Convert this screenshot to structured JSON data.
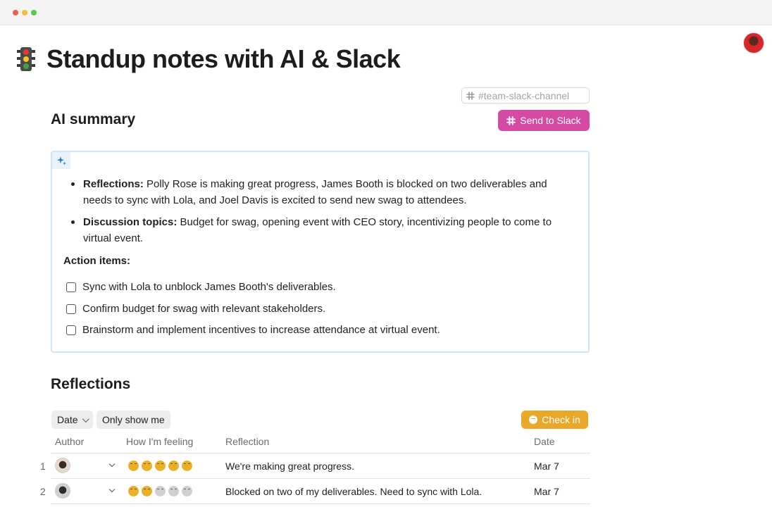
{
  "page": {
    "title": "Standup notes with AI & Slack",
    "icon": "traffic-light-icon"
  },
  "slack": {
    "channel_placeholder": "#team-slack-channel",
    "send_label": "Send to Slack",
    "accent": "#d54ba3"
  },
  "ai_summary": {
    "heading": "AI summary",
    "bullets": [
      {
        "label": "Reflections:",
        "text": " Polly Rose is making great progress, James Booth is blocked on two deliverables and needs to sync with Lola, and Joel Davis is excited to send new swag to attendees."
      },
      {
        "label": "Discussion topics:",
        "text": " Budget for swag, opening event with CEO story, incentivizing people to come to virtual event."
      }
    ],
    "action_heading": "Action items:",
    "actions": [
      "Sync with Lola to unblock James Booth's deliverables.",
      "Confirm budget for swag with relevant stakeholders.",
      "Brainstorm and implement incentives to increase attendance at virtual event."
    ]
  },
  "reflections": {
    "heading": "Reflections",
    "filters": [
      "Date",
      "Only show me"
    ],
    "checkin_label": "Check in",
    "checkin_color": "#e9a82a",
    "columns": [
      "Author",
      "How I'm feeling",
      "Reflection",
      "Date"
    ],
    "rows": [
      {
        "num": "1",
        "feeling": 5,
        "reflection": "We're making great progress.",
        "date": "Mar 7"
      },
      {
        "num": "2",
        "feeling": 2,
        "reflection": "Blocked on two of my deliverables. Need to sync with Lola.",
        "date": "Mar 7"
      }
    ]
  }
}
